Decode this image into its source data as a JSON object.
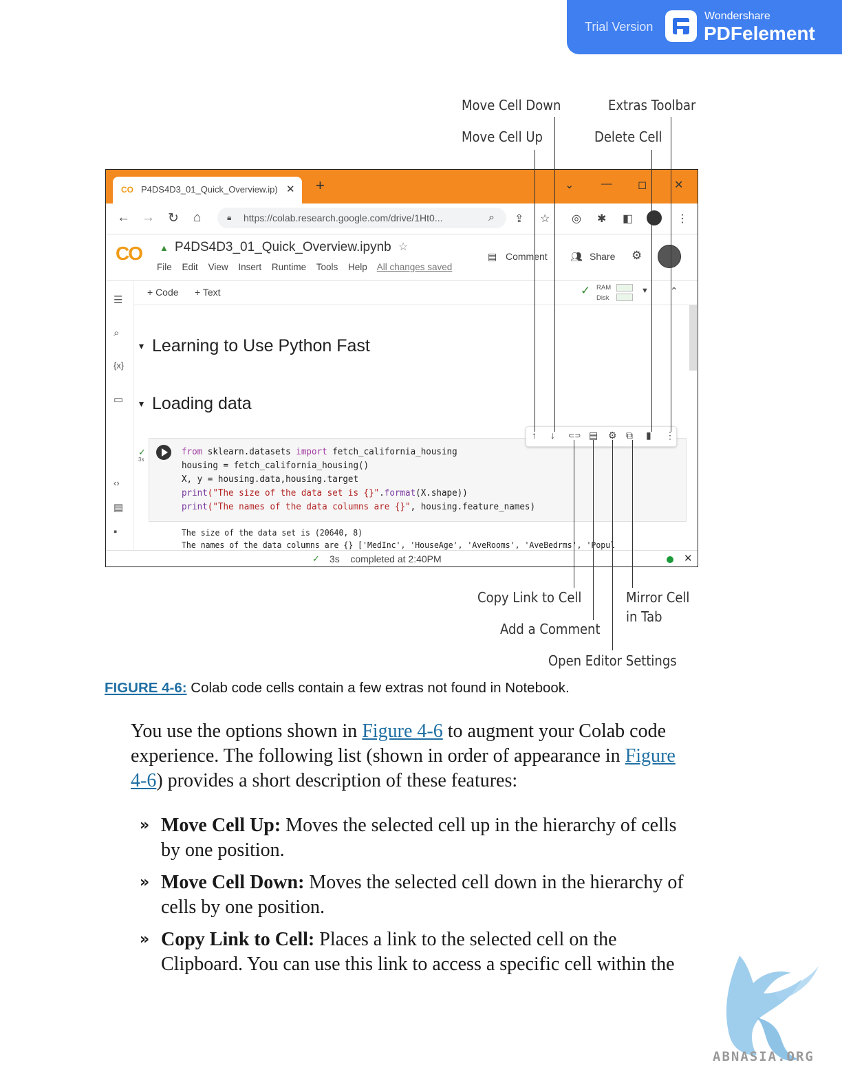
{
  "watermark": {
    "trial": "Trial Version",
    "brand": "Wondershare",
    "product": "PDFelement",
    "site": "ABNASIA.ORG",
    "brand_color": "#3f7ff0"
  },
  "callouts": {
    "move_cell_down": "Move Cell Down",
    "extras_toolbar": "Extras Toolbar",
    "move_cell_up": "Move Cell Up",
    "delete_cell": "Delete Cell",
    "copy_link": "Copy Link to Cell",
    "mirror_cell_1": "Mirror Cell",
    "mirror_cell_2": "in Tab",
    "add_comment": "Add a Comment",
    "editor_settings": "Open Editor Settings"
  },
  "browser": {
    "tab_title": "P4DS4D3_01_Quick_Overview.ip)",
    "tab_logo": "CO",
    "url": "https://colab.research.google.com/drive/1Ht0...",
    "titlebar_color": "#f3891f"
  },
  "colab": {
    "logo": "CO",
    "notebook_name": "P4DS4D3_01_Quick_Overview.ipynb",
    "menu": [
      "File",
      "Edit",
      "View",
      "Insert",
      "Runtime",
      "Tools",
      "Help"
    ],
    "saved": "All changes saved",
    "comment": "Comment",
    "share": "Share",
    "add_code": "+ Code",
    "add_text": "+ Text",
    "ram": "RAM",
    "disk": "Disk",
    "sections": [
      "Learning to Use Python Fast",
      "Loading data"
    ],
    "exec_time": "3s",
    "code": {
      "line1_kw1": "from",
      "line1_mod": " sklearn.datasets ",
      "line1_kw2": "import",
      "line1_rest": " fetch_california_housing",
      "line2": "housing = fetch_california_housing()",
      "line3": "X, y = housing.data,housing.target",
      "line4_fn": "print",
      "line4_str": "(\"The size of the data set is {}\"",
      "line4_mid": ".",
      "line4_fmt": "format",
      "line4_rest": "(X.shape))",
      "line5_fn": "print",
      "line5_str": "(\"The names of the data columns are {}\"",
      "line5_rest": ", housing.feature_names)"
    },
    "output": [
      "The size of the data set is (20640, 8)",
      "The names of the data columns are {} ['MedInc', 'HouseAge', 'AveRooms', 'AveBedrms', 'Popul"
    ],
    "status": "completed at 2:40PM"
  },
  "caption": {
    "label": "FIGURE 4-6:",
    "text": " Colab code cells contain a few extras not found in Notebook."
  },
  "body": {
    "p1_a": "You use the options shown in ",
    "p1_link1": "Figure 4-6",
    "p1_b": " to augment your Colab code",
    "p2_a": "experience. The following list (shown in order of appearance in ",
    "p2_link": "Figure",
    "p3_link": "4-6",
    "p3_b": ") provides a short description of these features:"
  },
  "bullets": [
    {
      "term": "Move Cell Up:",
      "line1": " Moves the selected cell up in the hierarchy of cells",
      "line2": "by one position."
    },
    {
      "term": "Move Cell Down:",
      "line1": " Moves the selected cell down in the hierarchy of",
      "line2": "cells by one position."
    },
    {
      "term": "Copy Link to Cell:",
      "line1": " Places a link to the selected cell on the",
      "line2": "Clipboard. You can use this link to access a specific cell within the"
    }
  ]
}
